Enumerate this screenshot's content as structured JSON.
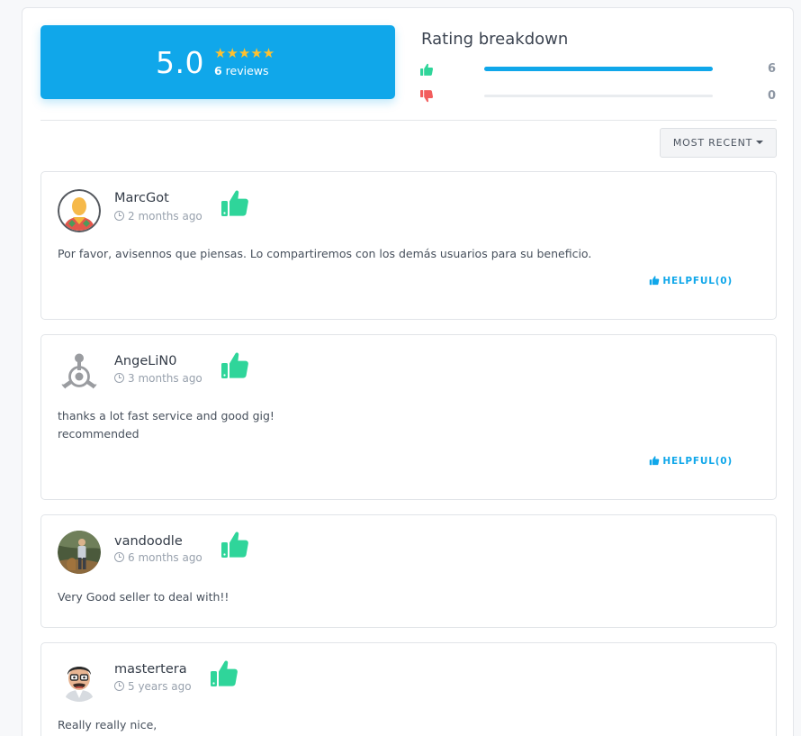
{
  "summary": {
    "score": "5.0",
    "stars": "★★★★★",
    "review_count": "6",
    "review_count_suffix": " reviews"
  },
  "breakdown": {
    "title": "Rating breakdown",
    "positive": {
      "icon": "thumbs-up-icon",
      "count": "6",
      "fraction": 1.0
    },
    "negative": {
      "icon": "thumbs-down-icon",
      "count": "0",
      "fraction": 0.0
    }
  },
  "sort": {
    "label": "MOST RECENT"
  },
  "colors": {
    "accent": "#10a7ea",
    "positive": "#2fd59a",
    "negative": "#f25d5d",
    "star": "#ffc12e"
  },
  "reviews": [
    {
      "user": "MarcGot",
      "time": "2 months ago",
      "text": "Por favor, avisennos que piensas. Lo compartiremos con los demás usuarios para su beneficio.",
      "helpful": "HELPFUL(0)",
      "verdict_icon": "thumbs-up-icon",
      "avatar_icon": "default-user-avatar"
    },
    {
      "user": "AngeLiN0",
      "time": "3 months ago",
      "text": "thanks a lot fast service and good gig!\nrecommended",
      "helpful": "HELPFUL(0)",
      "verdict_icon": "thumbs-up-icon",
      "avatar_icon": "gray-logo-avatar"
    },
    {
      "user": "vandoodle",
      "time": "6 months ago",
      "text": "Very Good seller to deal with!!",
      "verdict_icon": "thumbs-up-icon",
      "avatar_icon": "photo-avatar"
    },
    {
      "user": "mastertera",
      "time": "5 years ago",
      "text": "Really really nice,",
      "verdict_icon": "thumbs-up-icon",
      "avatar_icon": "cartoon-avatar"
    }
  ]
}
